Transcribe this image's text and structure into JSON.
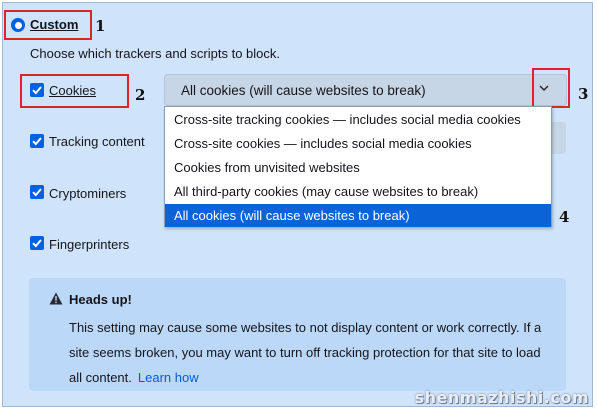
{
  "section": {
    "title": "Custom",
    "description": "Choose which trackers and scripts to block."
  },
  "options": {
    "cookies_label": "Cookies",
    "tracking_label": "Tracking content",
    "crypto_label": "Cryptominers",
    "finger_label": "Fingerprinters"
  },
  "select": {
    "value": "All cookies (will cause websites to break)",
    "items": [
      "Cross-site tracking cookies — includes social media cookies",
      "Cross-site cookies — includes social media cookies",
      "Cookies from unvisited websites",
      "All third-party cookies (may cause websites to break)",
      "All cookies (will cause websites to break)"
    ]
  },
  "notice": {
    "title": "Heads up!",
    "body": "This setting may cause some websites to not display content or work correctly. If a site seems broken, you may want to turn off tracking protection for that site to load all content.",
    "link": "Learn how"
  },
  "markers": [
    "1",
    "2",
    "3",
    "4"
  ],
  "watermark": "shenmazhishi.com",
  "colors": {
    "accent": "#0061e0",
    "annotation": "#e0222d",
    "panel": "#cfe4fb"
  }
}
